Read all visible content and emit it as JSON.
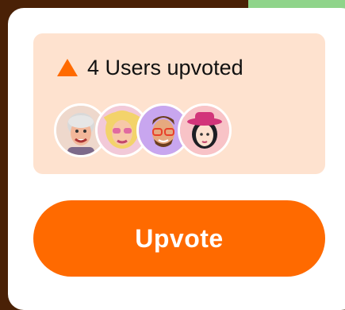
{
  "upvotes": {
    "summary_label": "4 Users upvoted",
    "icon": "triangle-up-icon",
    "accent_color": "#ff6a00",
    "avatars": [
      {
        "name": "avatar-elderly-woman",
        "bg": "#eed8cc"
      },
      {
        "name": "avatar-blonde-woman",
        "bg": "#f2c9d8"
      },
      {
        "name": "avatar-bearded-man",
        "bg": "#c8a6ef"
      },
      {
        "name": "avatar-woman-with-hat",
        "bg": "#f8c3c7"
      }
    ]
  },
  "action": {
    "upvote_label": "Upvote"
  }
}
